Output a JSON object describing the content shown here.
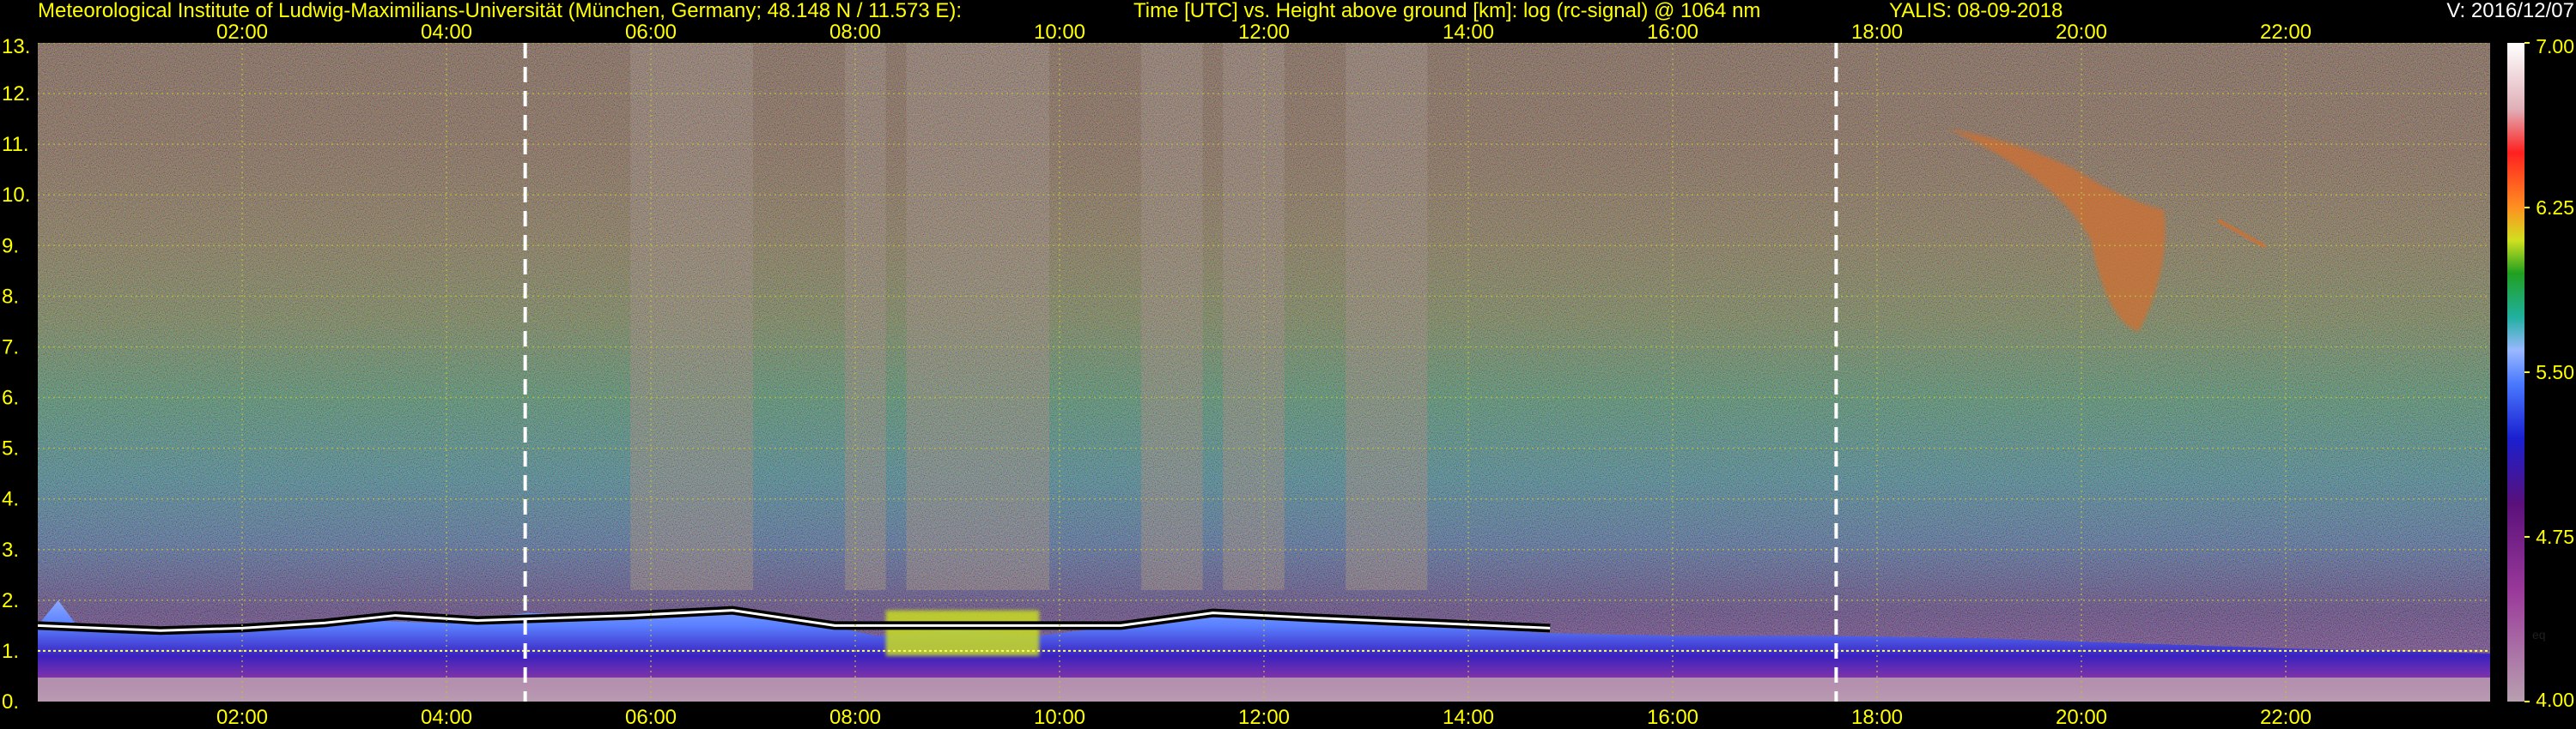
{
  "header": {
    "institute": "Meteorological Institute of Ludwig-Maximilians-Universität (München, Germany; 48.148 N / 11.573 E):",
    "plot_title": "Time [UTC] vs. Height above ground [km]: log (rc-signal) @ 1064 nm",
    "station_date": "YALIS: 08-09-2018",
    "version": "V: 2016/12/07"
  },
  "chart_data": {
    "type": "heatmap",
    "title": "Time [UTC] vs. Height above ground [km]: log (rc-signal) @ 1064 nm",
    "x_axis": {
      "unit": "hours UTC",
      "range": [
        0.0,
        24.0
      ],
      "ticks": [
        2,
        4,
        6,
        8,
        10,
        12,
        14,
        16,
        18,
        20,
        22
      ],
      "tick_labels": [
        "02:00",
        "04:00",
        "06:00",
        "08:00",
        "10:00",
        "12:00",
        "14:00",
        "16:00",
        "18:00",
        "20:00",
        "22:00"
      ],
      "positions": [
        "top",
        "bottom"
      ]
    },
    "y_axis": {
      "unit": "km",
      "range": [
        0,
        13
      ],
      "ticks": [
        0,
        1,
        2,
        3,
        4,
        5,
        6,
        7,
        8,
        9,
        10,
        11,
        12,
        13
      ],
      "tick_labels": [
        "0.",
        "1.",
        "2.",
        "3.",
        "4.",
        "5.",
        "6.",
        "7.",
        "8.",
        "9.",
        "10.",
        "11.",
        "12.",
        "13."
      ]
    },
    "grid": true,
    "markers": {
      "vertical_dashed_lines_hours": [
        4.77,
        17.6
      ],
      "dotted_horizontal_line_km": 1.0
    },
    "colorbar": {
      "range": [
        4.0,
        7.0
      ],
      "ticks": [
        4.0,
        4.75,
        5.5,
        6.25,
        7.0
      ],
      "tick_labels": [
        "4.00",
        "4.75",
        "5.50",
        "6.25",
        "7.00"
      ],
      "label": "eq",
      "stops": [
        {
          "v": 4.0,
          "color": "#b8a0b0"
        },
        {
          "v": 4.5,
          "color": "#9a3a9a"
        },
        {
          "v": 4.9,
          "color": "#5a107a"
        },
        {
          "v": 5.2,
          "color": "#1a20d0"
        },
        {
          "v": 5.45,
          "color": "#4a7aff"
        },
        {
          "v": 5.6,
          "color": "#9ab8ff"
        },
        {
          "v": 5.75,
          "color": "#20b0a0"
        },
        {
          "v": 5.95,
          "color": "#20a020"
        },
        {
          "v": 6.1,
          "color": "#d0e020"
        },
        {
          "v": 6.25,
          "color": "#ff9020"
        },
        {
          "v": 6.5,
          "color": "#ff2020"
        },
        {
          "v": 6.7,
          "color": "#e0b0b8"
        },
        {
          "v": 7.0,
          "color": "#ffffff"
        }
      ]
    },
    "features": {
      "boundary_layer_top_km": [
        [
          0.0,
          1.5
        ],
        [
          0.2,
          2.0
        ],
        [
          0.4,
          1.45
        ],
        [
          1.0,
          1.4
        ],
        [
          1.7,
          1.35
        ],
        [
          2.4,
          1.5
        ],
        [
          3.2,
          1.6
        ],
        [
          4.0,
          1.55
        ],
        [
          4.8,
          1.75
        ],
        [
          5.8,
          1.65
        ],
        [
          6.7,
          1.8
        ],
        [
          7.6,
          1.55
        ],
        [
          8.2,
          1.3
        ],
        [
          9.0,
          1.4
        ],
        [
          9.8,
          1.3
        ],
        [
          10.6,
          1.5
        ],
        [
          11.4,
          1.7
        ],
        [
          12.4,
          1.6
        ],
        [
          13.2,
          1.5
        ],
        [
          14.0,
          1.45
        ],
        [
          14.8,
          1.35
        ],
        [
          16.0,
          1.3
        ],
        [
          17.5,
          1.3
        ],
        [
          19.0,
          1.25
        ],
        [
          20.5,
          1.15
        ],
        [
          22.0,
          1.05
        ],
        [
          24.0,
          0.95
        ]
      ],
      "cloud_top_km": [
        [
          0.0,
          1.5
        ],
        [
          0.6,
          1.45
        ],
        [
          1.2,
          1.4
        ],
        [
          2.0,
          1.45
        ],
        [
          2.8,
          1.55
        ],
        [
          3.5,
          1.7
        ],
        [
          4.3,
          1.6
        ],
        [
          5.8,
          1.7
        ],
        [
          6.8,
          1.8
        ],
        [
          7.8,
          1.5
        ],
        [
          10.6,
          1.5
        ],
        [
          11.5,
          1.75
        ],
        [
          12.5,
          1.65
        ],
        [
          14.8,
          1.45
        ]
      ],
      "bright_aerosol_patch": {
        "x_hours": [
          8.3,
          9.8
        ],
        "y_km": [
          0.9,
          1.8
        ]
      },
      "cirrus_patch": {
        "x_hours": [
          18.7,
          21.8
        ],
        "y_km": [
          7.3,
          11.3
        ]
      },
      "noise_columns_hours": [
        [
          5.8,
          7.0
        ],
        [
          7.9,
          8.3
        ],
        [
          8.5,
          9.9
        ],
        [
          10.8,
          11.4
        ],
        [
          11.6,
          12.2
        ],
        [
          12.8,
          13.6
        ]
      ]
    }
  }
}
